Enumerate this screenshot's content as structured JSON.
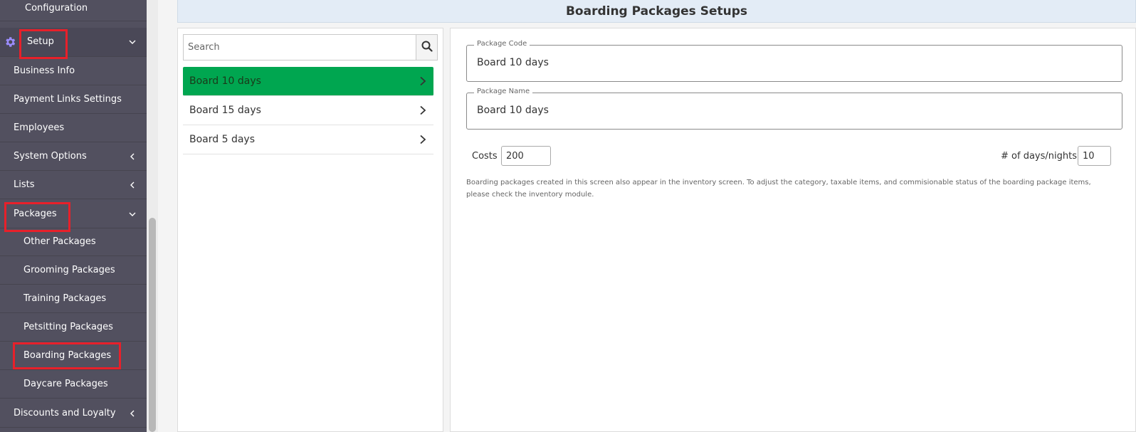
{
  "sidebar": {
    "configuration": "Configuration",
    "setup": "Setup",
    "items": [
      {
        "label": "Business Info"
      },
      {
        "label": "Payment Links Settings"
      },
      {
        "label": "Employees"
      },
      {
        "label": "System Options"
      },
      {
        "label": "Lists"
      },
      {
        "label": "Packages"
      },
      {
        "label": "Other Packages"
      },
      {
        "label": "Grooming Packages"
      },
      {
        "label": "Training Packages"
      },
      {
        "label": "Petsitting Packages"
      },
      {
        "label": "Boarding Packages"
      },
      {
        "label": "Daycare Packages"
      },
      {
        "label": "Discounts and Loyalty"
      }
    ]
  },
  "header": {
    "title": "Boarding Packages Setups"
  },
  "search": {
    "placeholder": "Search",
    "value": ""
  },
  "packages": [
    {
      "label": "Board 10 days"
    },
    {
      "label": "Board 15 days"
    },
    {
      "label": "Board 5 days"
    }
  ],
  "form": {
    "package_code_label": "Package Code",
    "package_code_value": "Board 10 days",
    "package_name_label": "Package Name",
    "package_name_value": "Board 10 days",
    "costs_label": "Costs",
    "costs_value": "200",
    "days_label": "# of days/nights",
    "days_value": "10",
    "note": "Boarding packages created in this screen also appear in the inventory screen. To adjust the category, taxable items, and commisionable status of the boarding package items, please check the inventory module."
  },
  "colors": {
    "sidebar_bg": "#52505f",
    "active_item": "#00a650",
    "highlight_box": "#e8202a",
    "header_bg": "#e3ecf6",
    "gear_icon": "#9b8cff"
  },
  "icons": [
    "gear-icon",
    "chevron-down-icon",
    "chevron-left-icon",
    "chevron-right-icon",
    "search-icon"
  ]
}
